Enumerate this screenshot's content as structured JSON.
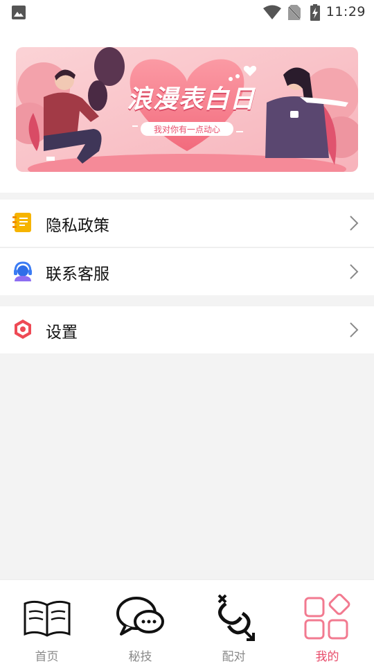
{
  "status_bar": {
    "time": "11:29",
    "icons": [
      "image-icon",
      "wifi-icon",
      "no-sim-icon",
      "battery-charging-icon"
    ]
  },
  "banner": {
    "title": "浪漫表白日",
    "subtitle": "我对你有一点动心",
    "colors": {
      "background": "#f9c6cc",
      "heart": "#f57f8c",
      "accent": "#e84d6b"
    }
  },
  "menu": {
    "items": [
      {
        "label": "隐私政策",
        "icon": "notebook-icon"
      },
      {
        "label": "联系客服",
        "icon": "customer-service-icon"
      },
      {
        "label": "设置",
        "icon": "settings-icon"
      }
    ]
  },
  "tabs": [
    {
      "label": "首页",
      "icon": "book-icon",
      "active": false
    },
    {
      "label": "秘技",
      "icon": "chat-bubbles-icon",
      "active": false
    },
    {
      "label": "配对",
      "icon": "gender-link-icon",
      "active": false
    },
    {
      "label": "我的",
      "icon": "apps-grid-icon",
      "active": true
    }
  ],
  "colors": {
    "active_tab": "#e84d6b",
    "inactive_tab": "#8a8a8a",
    "page_bg": "#f3f3f3"
  }
}
